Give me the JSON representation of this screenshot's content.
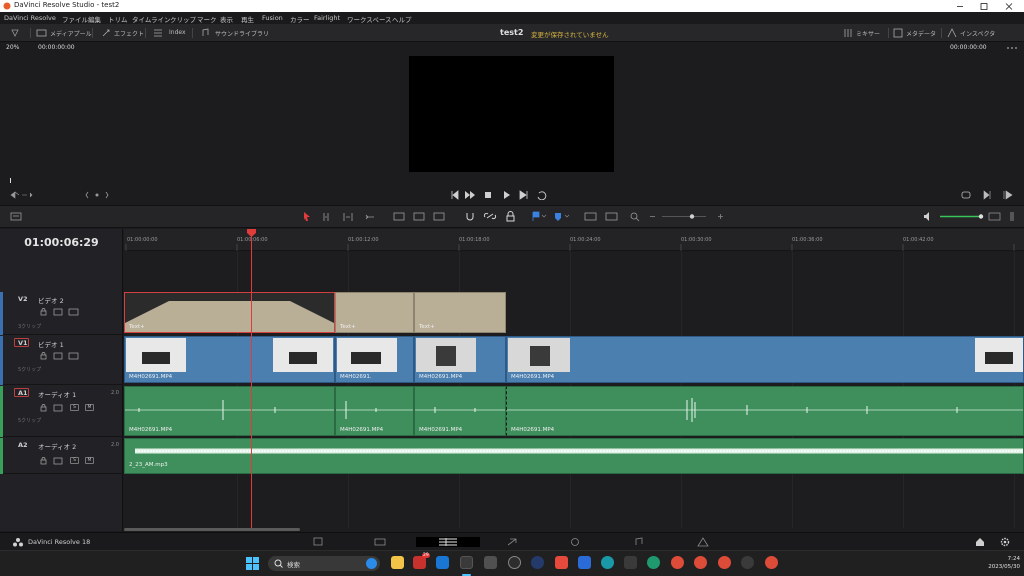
{
  "window": {
    "title": "DaVinci Resolve Studio - test2"
  },
  "menu": [
    "DaVinci Resolve",
    "ファイル",
    "編集",
    "トリム",
    "タイムライン",
    "クリップ",
    "マーク",
    "表示",
    "再生",
    "Fusion",
    "カラー",
    "Fairlight",
    "ワークスペース",
    "ヘルプ"
  ],
  "toolbar": {
    "media_pool": "メディアプール",
    "effects": "エフェクト",
    "index": "Index",
    "sound_library": "サウンドライブラリ",
    "project_name": "test2",
    "status": "変更が保存されていません",
    "mixer": "ミキサー",
    "metadata": "メタデータ",
    "inspector": "インスペクタ"
  },
  "viewer": {
    "zoom": "20%",
    "timecode_left": "00:00:00:00",
    "timecode_right": "00:00:00:00"
  },
  "timeline": {
    "current_timecode": "01:00:06:29",
    "ruler": [
      "01:00:00:00",
      "01:00:06:00",
      "01:00:12:00",
      "01:00:18:00",
      "01:00:24:00",
      "01:00:30:00",
      "01:00:36:00",
      "01:00:42:00"
    ],
    "tracks": [
      {
        "id": "V2",
        "name": "ビデオ 2",
        "sub": "3クリップ"
      },
      {
        "id": "V1",
        "name": "ビデオ 1",
        "sub": "5クリップ"
      },
      {
        "id": "A1",
        "name": "オーディオ 1",
        "sub": "5クリップ",
        "volume": "2.0",
        "btn_s": "S",
        "btn_m": "M"
      },
      {
        "id": "A2",
        "name": "オーディオ 2",
        "sub": "1クリップ",
        "volume": "2.0",
        "btn_s": "S",
        "btn_m": "M"
      }
    ],
    "v2_clips": [
      "Text+",
      "Text+",
      "Text+"
    ],
    "v1_clips": [
      "M4H02691.MP4",
      "M4H02691.",
      "M4H02691.MP4",
      "M4H02691.MP4"
    ],
    "a1_clips": [
      "M4H02691.MP4",
      "M4H02691.MP4",
      "M4H02691.MP4",
      "M4H02691.MP4"
    ],
    "a2_clip": "2_23_AM.mp3"
  },
  "pagebar": {
    "brand": "DaVinci Resolve 18"
  },
  "taskbar": {
    "search_placeholder": "検索",
    "time": "7:24",
    "date": "2023/05/30",
    "badge": "29"
  },
  "colors": {
    "accent_red": "#e23b3b",
    "video_clip": "#4a7fb0",
    "audio_clip": "#3f8f5c",
    "title_clip": "#b9ae96",
    "status_yellow": "#d8b640"
  }
}
